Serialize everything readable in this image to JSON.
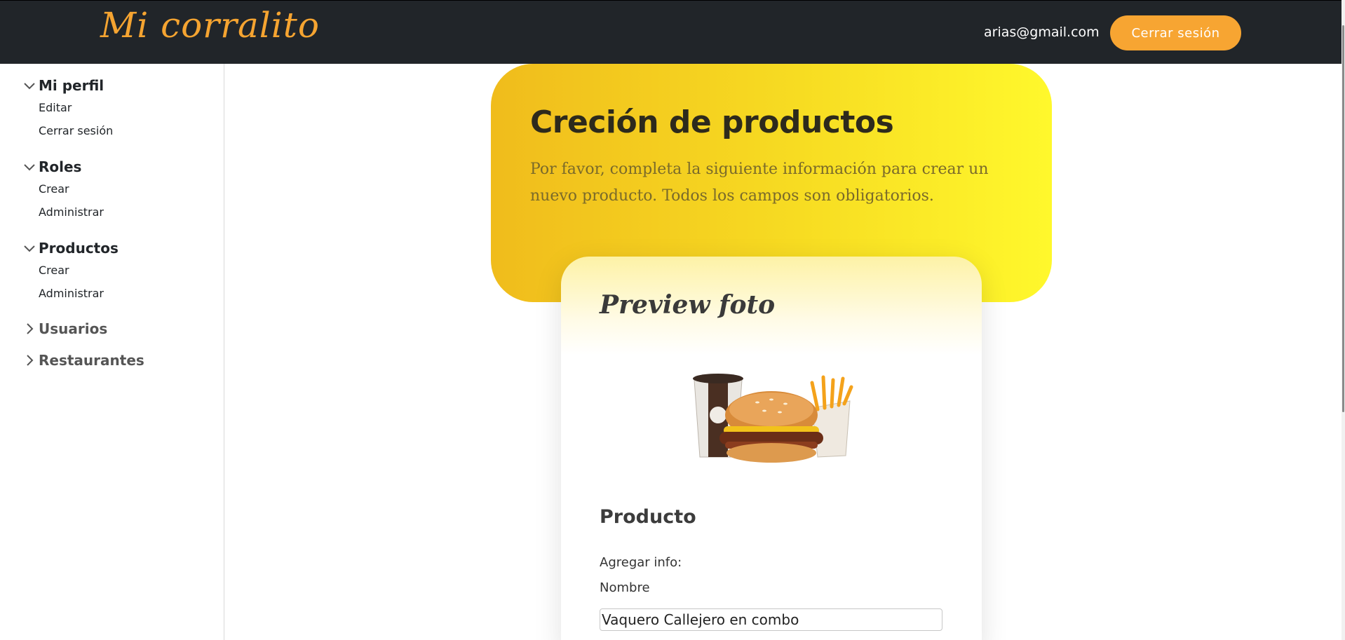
{
  "header": {
    "brand": "Mi corralito",
    "user_email": "arias@gmail.com",
    "logout_label": "Cerrar sesión"
  },
  "sidebar": {
    "groups": [
      {
        "label": "Mi perfil",
        "expanded": true,
        "items": [
          "Editar",
          "Cerrar sesión"
        ]
      },
      {
        "label": "Roles",
        "expanded": true,
        "items": [
          "Crear",
          "Administrar"
        ]
      },
      {
        "label": "Productos",
        "expanded": true,
        "items": [
          "Crear",
          "Administrar"
        ]
      },
      {
        "label": "Usuarios",
        "expanded": false,
        "items": []
      },
      {
        "label": "Restaurantes",
        "expanded": false,
        "items": []
      }
    ]
  },
  "hero": {
    "title": "Creción de productos",
    "description": "Por favor, completa la siguiente información para crear un nuevo producto. Todos los campos son obligatorios."
  },
  "card": {
    "preview_title": "Preview foto",
    "image_icon": "burger-combo-image",
    "section_title": "Producto",
    "add_info_label": "Agregar info:",
    "name_label": "Nombre",
    "name_value": "Vaquero Callejero en combo"
  },
  "colors": {
    "header_bg": "#212529",
    "brand": "#f5a431",
    "accent_button": "#f7a532",
    "hero_gradient_start": "#f0bc1c",
    "hero_gradient_end": "#fff82c"
  }
}
